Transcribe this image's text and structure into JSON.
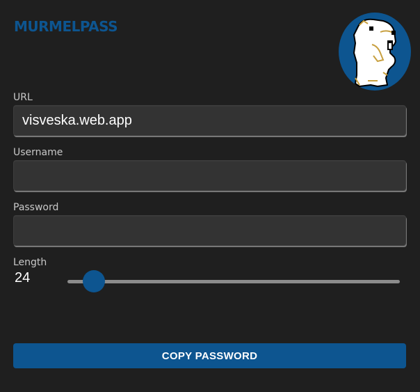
{
  "app": {
    "title": "MURMELPASS",
    "logo_icon": "marmot-logo-icon"
  },
  "form": {
    "url": {
      "label": "URL",
      "value": "visveska.web.app",
      "placeholder": ""
    },
    "username": {
      "label": "Username",
      "value": "",
      "placeholder": ""
    },
    "password": {
      "label": "Password",
      "value": "",
      "placeholder": ""
    },
    "length": {
      "label": "Length",
      "value": "24",
      "slider_fraction": 0.05
    }
  },
  "actions": {
    "copy_label": "COPY PASSWORD"
  },
  "colors": {
    "background": "#1f1f1f",
    "accent": "#0d5590",
    "field_background": "#333333",
    "label_text": "#c8c8c8"
  }
}
